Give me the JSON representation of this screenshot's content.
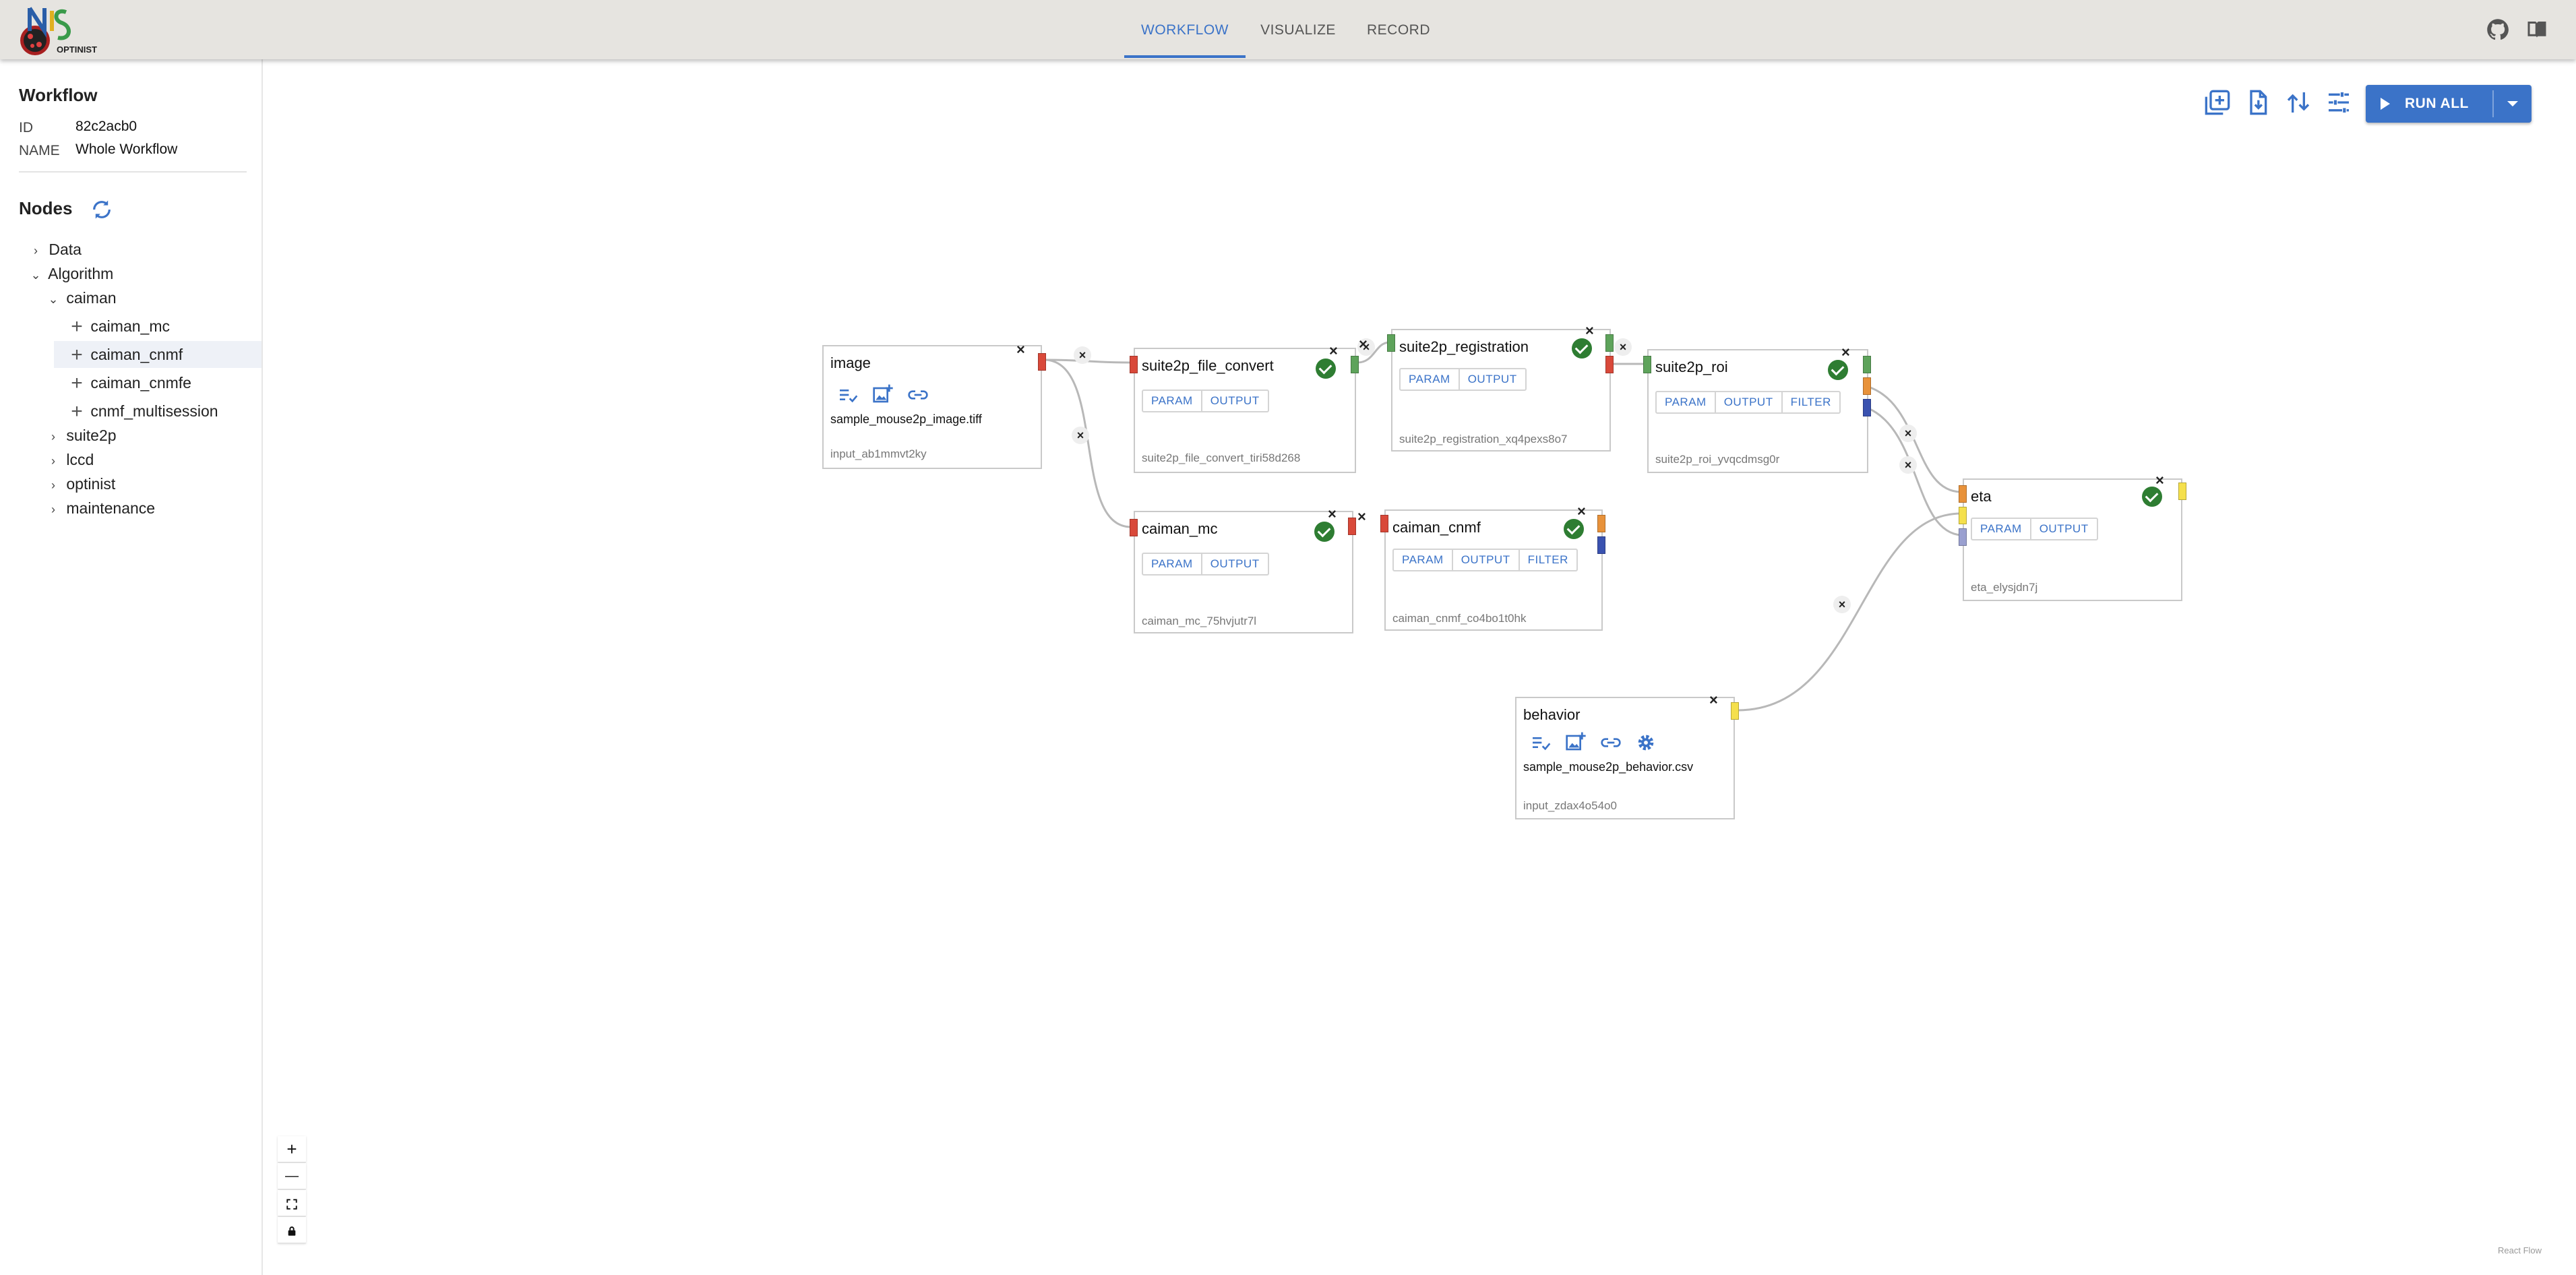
{
  "appbar": {
    "tabs": [
      {
        "label": "WORKFLOW",
        "active": true
      },
      {
        "label": "VISUALIZE",
        "active": false
      },
      {
        "label": "RECORD",
        "active": false
      }
    ],
    "icons": [
      "github-icon",
      "book-icon"
    ]
  },
  "workflow": {
    "title": "Workflow",
    "id_label": "ID",
    "id_value": "82c2acb0",
    "name_label": "NAME",
    "name_value": "Whole Workflow"
  },
  "nodes_panel": {
    "title": "Nodes",
    "tree": [
      {
        "label": "Data",
        "kind": "collapsed"
      },
      {
        "label": "Algorithm",
        "kind": "expanded"
      },
      {
        "label": "caiman",
        "kind": "expanded"
      },
      {
        "label": "caiman_mc",
        "kind": "leaf"
      },
      {
        "label": "caiman_cnmf",
        "kind": "leaf",
        "selected": true
      },
      {
        "label": "caiman_cnmfe",
        "kind": "leaf"
      },
      {
        "label": "cnmf_multisession",
        "kind": "leaf"
      },
      {
        "label": "suite2p",
        "kind": "collapsed"
      },
      {
        "label": "lccd",
        "kind": "collapsed"
      },
      {
        "label": "optinist",
        "kind": "collapsed"
      },
      {
        "label": "maintenance",
        "kind": "collapsed"
      }
    ]
  },
  "toolbar": {
    "run_all_label": "RUN ALL",
    "icons": [
      "add-workflow-icon",
      "import-file-icon",
      "compare-icon",
      "settings-sliders-icon"
    ]
  },
  "graph": {
    "image": {
      "title": "image",
      "file": "sample_mouse2p_image.tiff",
      "id": "input_ab1mmvt2ky"
    },
    "suite2p_file_convert": {
      "title": "suite2p_file_convert",
      "id": "suite2p_file_convert_tiri58d268"
    },
    "suite2p_registration": {
      "title": "suite2p_registration",
      "id": "suite2p_registration_xq4pexs8o7"
    },
    "suite2p_roi": {
      "title": "suite2p_roi",
      "id": "suite2p_roi_yvqcdmsg0r"
    },
    "caiman_mc": {
      "title": "caiman_mc",
      "id": "caiman_mc_75hvjutr7l"
    },
    "caiman_cnmf": {
      "title": "caiman_cnmf",
      "id": "caiman_cnmf_co4bo1t0hk"
    },
    "eta": {
      "title": "eta",
      "id": "eta_elysjdn7j"
    },
    "behavior": {
      "title": "behavior",
      "file": "sample_mouse2p_behavior.csv",
      "id": "input_zdax4o54o0"
    },
    "btn_param": "PARAM",
    "btn_output": "OUTPUT",
    "btn_filter": "FILTER",
    "close_glyph": "×",
    "colors": {
      "red": "#d9493a",
      "green": "#5ea35b",
      "orange": "#e8923a",
      "blue": "#3a52b0",
      "yellow": "#f5e04c",
      "lavender": "#9aa0d0",
      "check_green": "#2e7d32",
      "accent": "#3b73c8"
    }
  },
  "zoom_controls": [
    "+",
    "—",
    "fit",
    "lock"
  ],
  "watermark": "React Flow"
}
